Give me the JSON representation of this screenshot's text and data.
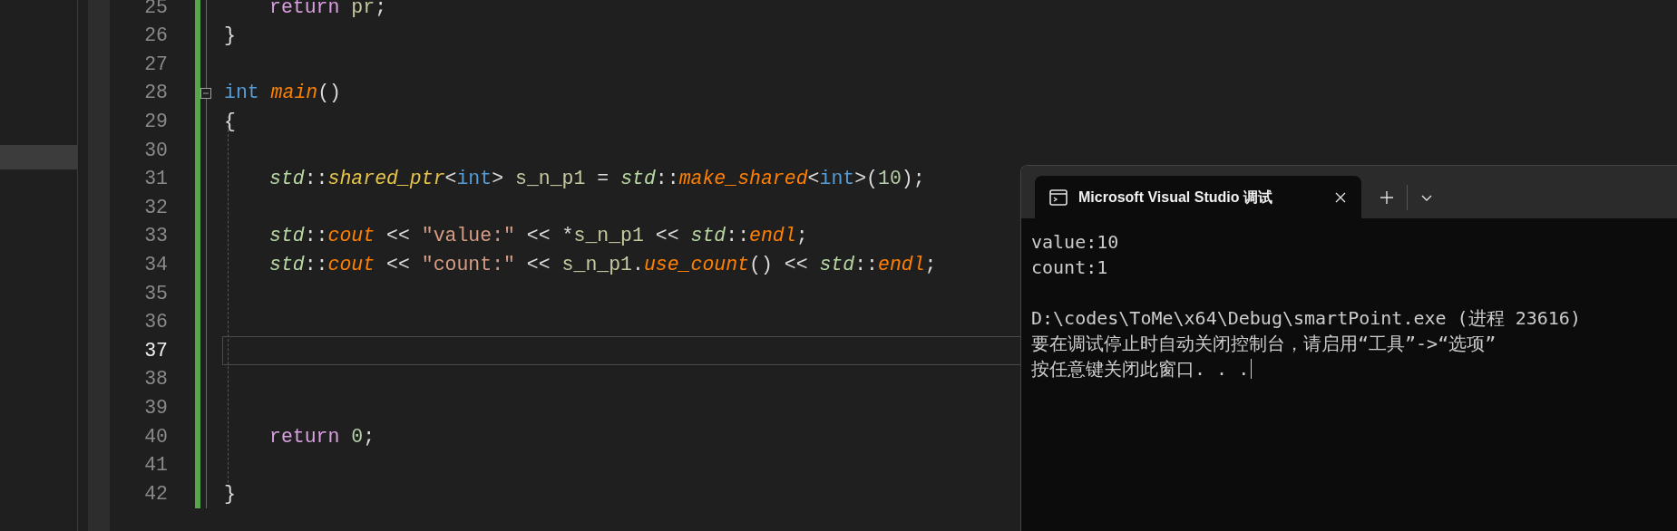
{
  "editor": {
    "lines": [
      {
        "number": "25",
        "indented": true,
        "current": false,
        "tokens": [
          {
            "kind": "control",
            "text": "return"
          },
          {
            "kind": "var",
            "text": " pr"
          },
          {
            "kind": "punct",
            "text": ";"
          }
        ]
      },
      {
        "number": "26",
        "indented": false,
        "current": false,
        "tokens": [
          {
            "kind": "punct",
            "text": "}"
          }
        ]
      },
      {
        "number": "27",
        "current": false
      },
      {
        "number": "28",
        "indented": false,
        "current": false,
        "fold": true,
        "tokens": [
          {
            "kind": "keyword",
            "text": "int "
          },
          {
            "kind": "func",
            "text": "main"
          },
          {
            "kind": "punct",
            "text": "()"
          }
        ]
      },
      {
        "number": "29",
        "indented": false,
        "current": false,
        "tokens": [
          {
            "kind": "punct",
            "text": "{"
          }
        ]
      },
      {
        "number": "30",
        "current": false
      },
      {
        "number": "31",
        "indented": true,
        "current": false,
        "tokens": [
          {
            "kind": "ns",
            "text": "std"
          },
          {
            "kind": "punct",
            "text": "::"
          },
          {
            "kind": "type",
            "text": "shared_ptr"
          },
          {
            "kind": "punct",
            "text": "<"
          },
          {
            "kind": "keyword",
            "text": "int"
          },
          {
            "kind": "punct",
            "text": ">"
          },
          {
            "kind": "var",
            "text": " s_n_p1 "
          },
          {
            "kind": "punct",
            "text": "= "
          },
          {
            "kind": "ns",
            "text": "std"
          },
          {
            "kind": "punct",
            "text": "::"
          },
          {
            "kind": "func",
            "text": "make_shared"
          },
          {
            "kind": "punct",
            "text": "<"
          },
          {
            "kind": "keyword",
            "text": "int"
          },
          {
            "kind": "punct",
            "text": ">("
          },
          {
            "kind": "number",
            "text": "10"
          },
          {
            "kind": "punct",
            "text": ");"
          }
        ]
      },
      {
        "number": "32",
        "current": false
      },
      {
        "number": "33",
        "indented": true,
        "current": false,
        "tokens": [
          {
            "kind": "ns",
            "text": "std"
          },
          {
            "kind": "punct",
            "text": "::"
          },
          {
            "kind": "func",
            "text": "cout"
          },
          {
            "kind": "punct",
            "text": " << "
          },
          {
            "kind": "string",
            "text": "\"value:\""
          },
          {
            "kind": "punct",
            "text": " << *"
          },
          {
            "kind": "var",
            "text": "s_n_p1"
          },
          {
            "kind": "punct",
            "text": " << "
          },
          {
            "kind": "ns",
            "text": "std"
          },
          {
            "kind": "punct",
            "text": "::"
          },
          {
            "kind": "func",
            "text": "endl"
          },
          {
            "kind": "punct",
            "text": ";"
          }
        ]
      },
      {
        "number": "34",
        "indented": true,
        "current": false,
        "tokens": [
          {
            "kind": "ns",
            "text": "std"
          },
          {
            "kind": "punct",
            "text": "::"
          },
          {
            "kind": "func",
            "text": "cout"
          },
          {
            "kind": "punct",
            "text": " << "
          },
          {
            "kind": "string",
            "text": "\"count:\""
          },
          {
            "kind": "punct",
            "text": " << "
          },
          {
            "kind": "var",
            "text": "s_n_p1"
          },
          {
            "kind": "punct",
            "text": "."
          },
          {
            "kind": "func",
            "text": "use_count"
          },
          {
            "kind": "punct",
            "text": "() << "
          },
          {
            "kind": "ns",
            "text": "std"
          },
          {
            "kind": "punct",
            "text": "::"
          },
          {
            "kind": "func",
            "text": "endl"
          },
          {
            "kind": "punct",
            "text": ";"
          }
        ]
      },
      {
        "number": "35",
        "current": false
      },
      {
        "number": "36",
        "current": false
      },
      {
        "number": "37",
        "current": true
      },
      {
        "number": "38",
        "current": false
      },
      {
        "number": "39",
        "current": false
      },
      {
        "number": "40",
        "indented": true,
        "current": false,
        "tokens": [
          {
            "kind": "control",
            "text": "return "
          },
          {
            "kind": "number",
            "text": "0"
          },
          {
            "kind": "punct",
            "text": ";"
          }
        ]
      },
      {
        "number": "41",
        "current": false
      },
      {
        "number": "42",
        "indented": false,
        "current": false,
        "tokens": [
          {
            "kind": "punct",
            "text": "}"
          }
        ]
      }
    ]
  },
  "terminal": {
    "tabs": [
      {
        "title": "Microsoft Visual Studio 调试",
        "selected": true
      }
    ],
    "program_output": [
      "value:10",
      "count:1"
    ],
    "exit_messages": [
      "D:\\codes\\ToMe\\x64\\Debug\\smartPoint.exe (进程 23616)",
      "要在调试停止时自动关闭控制台，请启用“工具”->“选项”",
      "按任意键关闭此窗口. . ."
    ]
  }
}
